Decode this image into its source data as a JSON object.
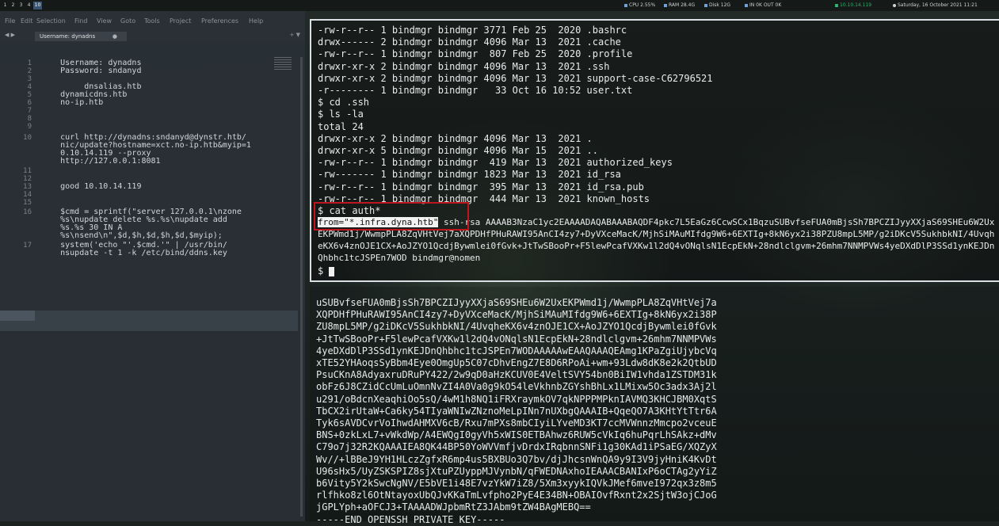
{
  "topbar": {
    "workspaces": [
      "1",
      "2",
      "3",
      "4",
      "10"
    ],
    "cpu": "CPU 2.55%",
    "ram": "RAM 28.4G",
    "disk": "Disk 12G",
    "net": "IN 0K OUT 0K",
    "ip": "10.10.14.119",
    "datetime": "Saturday, 16 October 2021 11:21"
  },
  "editor": {
    "menu": [
      "File",
      "Edit",
      "Selection",
      "Find",
      "View",
      "Goto",
      "Tools",
      "Project",
      "Preferences",
      "Help"
    ],
    "tab_label": "Username: dynadns",
    "tab_close": "●",
    "nav_arrows": "◀ ▶",
    "tab_menu": "+ ▼",
    "gutter": [
      {
        "n": "1",
        "t": "      Username: dynadns"
      },
      {
        "n": "2",
        "t": "      Password: sndanyd"
      },
      {
        "n": "3",
        "t": ""
      },
      {
        "n": "4",
        "t": "           dnsalias.htb"
      },
      {
        "n": "5",
        "t": "      dynamicdns.htb"
      },
      {
        "n": "6",
        "t": "      no-ip.htb"
      },
      {
        "n": "7",
        "t": ""
      },
      {
        "n": "8",
        "t": ""
      },
      {
        "n": "9",
        "t": ""
      },
      {
        "n": "10",
        "t": "      curl http://dynadns:sndanyd@dynstr.htb/"
      },
      {
        "n": "",
        "t": "      nic/update?hostname=xct.no-ip.htb&myip=1"
      },
      {
        "n": "",
        "t": "      0.10.14.119 --proxy"
      },
      {
        "n": "",
        "t": "      http://127.0.0.1:8081"
      },
      {
        "n": "11",
        "t": ""
      },
      {
        "n": "12",
        "t": ""
      },
      {
        "n": "13",
        "t": "      good 10.10.14.119"
      },
      {
        "n": "14",
        "t": ""
      },
      {
        "n": "15",
        "t": ""
      },
      {
        "n": "16",
        "t": "      $cmd = sprintf(\"server 127.0.0.1\\nzone"
      },
      {
        "n": "",
        "t": "      %s\\nupdate delete %s.%s\\nupdate add"
      },
      {
        "n": "",
        "t": "      %s.%s 30 IN A"
      },
      {
        "n": "",
        "t": "      %s\\nsend\\n\",$d,$h,$d,$h,$d,$myip);"
      },
      {
        "n": "17",
        "t": "      system('echo \"'.$cmd.'\" | /usr/bin/"
      },
      {
        "n": "",
        "t": "      nsupdate -t 1 -k /etc/bind/ddns.key"
      }
    ]
  },
  "terminal1": {
    "lines": [
      "-rw-r--r-- 1 bindmgr bindmgr 3771 Feb 25  2020 .bashrc",
      "drwx------ 2 bindmgr bindmgr 4096 Mar 13  2021 .cache",
      "-rw-r--r-- 1 bindmgr bindmgr  807 Feb 25  2020 .profile",
      "drwxr-xr-x 2 bindmgr bindmgr 4096 Mar 13  2021 .ssh",
      "drwxr-xr-x 2 bindmgr bindmgr 4096 Mar 13  2021 support-case-C62796521",
      "-r-------- 1 bindmgr bindmgr   33 Oct 16 10:52 user.txt",
      "$ cd .ssh",
      "$ ls -la",
      "total 24",
      "drwxr-xr-x 2 bindmgr bindmgr 4096 Mar 13  2021 .",
      "drwxr-xr-x 5 bindmgr bindmgr 4096 Mar 15  2021 ..",
      "-rw-r--r-- 1 bindmgr bindmgr  419 Mar 13  2021 authorized_keys",
      "-rw------- 1 bindmgr bindmgr 1823 Mar 13  2021 id_rsa",
      "-rw-r--r-- 1 bindmgr bindmgr  395 Mar 13  2021 id_rsa.pub",
      "-rw-r--r-- 1 bindmgr bindmgr  444 Mar 13  2021 known_hosts",
      "$ cat auth*"
    ],
    "from_option": "from=\"*.infra.dyna.htb\"",
    "key_rest": " ssh-rsa AAAAB3NzaC1yc2EAAAADAQABAAABAQDF4pkc7L5EaGz6CcwSCx1BqzuSUBvfseFUA0mBjsSh7BPCZIJyyXXjaS69SHEu6W2UxEKPWmd1j/WwmpPLA8ZqVHtVej7aXQPDHfPHuRAWI95AnCI4zy7+DyVXceMacK/MjhSiMAuMIfdg9W6+6EXTIg+8kN6yx2i38PZU8mpL5MP/g2iDKcV5SukhbkNI/4UvqheKX6v4znOJE1CX+AoJZYO1QcdjBywmlei0fGvk+JtTwSBooPr+F5lewPcafVXKw1l2dQ4vONqlsN1EcpEkN+28ndlclgvm+26mhm7NNMPVWs4yeDXdDlP3SSd1ynKEJDnQhbhc1tcJSPEn7WOD bindmgr@nomen",
    "prompt": "$ "
  },
  "terminal2": {
    "lines": [
      "uSUBvfseFUA0mBjsSh7BPCZIJyyXXjaS69SHEu6W2UxEKPWmd1j/WwmpPLA8ZqVHtVej7a",
      "XQPDHfPHuRAWI95AnCI4zy7+DyVXceMacK/MjhSiMAuMIfdg9W6+6EXTIg+8kN6yx2i38P",
      "ZU8mpL5MP/g2iDKcV5SukhbkNI/4UvqheKX6v4znOJE1CX+AoJZYO1QcdjBywmlei0fGvk",
      "+JtTwSBooPr+F5lewPcafVXKw1l2dQ4vONqlsN1EcpEkN+28ndlclgvm+26mhm7NNMPVWs",
      "4yeDXdDlP3SSd1ynKEJDnQhbhc1tcJSPEn7WODAAAAAwEAAQAAAQEAmg1KPaZgiUjybcVq",
      "xTE52YHAoqsSyBbm4Eye0OmgUp5C07cDhvEngZ7E8D6RPoAi+wm+93Ldw8dK8e2k2QtbUD",
      "PsuCKnA8AdyaxruDRuPY422/2w9qD0aHzKCUV0E4VeltSVY54bn0BiIW1vhda1ZSTDM31k",
      "obFz6J8CZidCcUmLuOmnNvZI4A0Va0g9kO54leVkhnbZGYshBhLx1LMixw5Oc3adx3Aj2l",
      "u291/oBdcnXeaqhiOo5sQ/4wM1h8NQ1iFRXraymkOV7qkNPPPMPknIAVMQ3KHCJBM0XqtS",
      "TbCX2irUtaW+Ca6ky54TIyaWNIwZNznoMeLpINn7nUXbgQAAAIB+QqeQO7A3KHtYtTtr6A",
      "Tyk6sAVDCvrVoIhwdAHMXV6cB/Rxu7mPXs8mbCIyiLYveMD3KT7ccMVWnnzMmcpo2vceuE",
      "BNS+0zkLxL7+vWkdWp/A4EWQgI0gyVh5xWIS0ETBAhwz6RUW5cVkIq6huPqrLhSAkz+dMv",
      "C79o7j32R2KQAAAIEA8QK44BP50YoWVVmfjvDrdxIRqbnnSNFi1g30KAd1iPSaEG/XQZyX",
      "Wv//+lBBeJ9YH1HLczZgfxR6mp4us5BXBUo3Q7bv/djJhcsnWnQA9y9I3V9jyHniK4KvDt",
      "U96sHx5/UyZSKSPIZ8sjXtuPZUyppMJVynbN/qFWEDNAxhoIEAAACBANIxP6oCTAg2yYiZ",
      "b6Vity5Y2kSwcNgNV/E5bVE1i48E7vzYkW7iZ8/5Xm3xyykIQVkJMef6mveI972qx3z8m5",
      "rlfhko8zl6OtNtayoxUbQJvKKaTmLvfpho2PyE4E34BN+OBAIOvfRxnt2x2SjtW3ojCJoG",
      "jGPLYph+aOFCJ3+TAAAADWJpbmRtZ3JAbm9tZW4BAgMEBQ==",
      "-----END OPENSSH PRIVATE KEY-----"
    ]
  }
}
